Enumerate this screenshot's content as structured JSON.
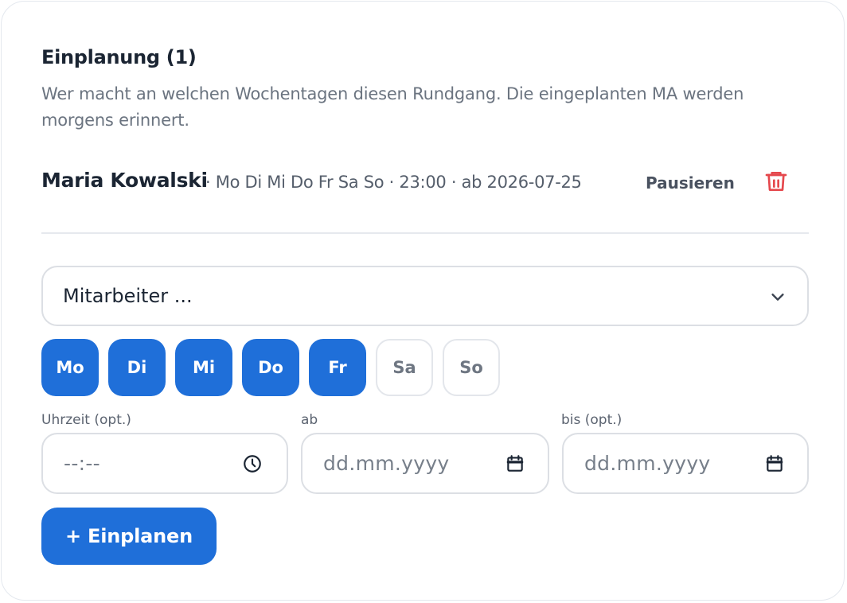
{
  "planning": {
    "title": "Einplanung (1)",
    "description": "Wer macht an welchen Wochentagen diesen Rundgang. Die eingeplanten MA werden morgens erinnert."
  },
  "assignments": [
    {
      "name": "Maria Kowalski",
      "meta": "· Mo Di Mi Do Fr Sa So · 23:00 · ab 2026-07-25",
      "pause_label": "Pausieren",
      "delete_icon": "trash-icon"
    }
  ],
  "form": {
    "employee_select": {
      "value": "Mitarbeiter ...",
      "icon": "chevron-down-icon"
    },
    "days": [
      {
        "label": "Mo",
        "selected": true
      },
      {
        "label": "Di",
        "selected": true
      },
      {
        "label": "Mi",
        "selected": true
      },
      {
        "label": "Do",
        "selected": true
      },
      {
        "label": "Fr",
        "selected": true
      },
      {
        "label": "Sa",
        "selected": false
      },
      {
        "label": "So",
        "selected": false
      }
    ],
    "time": {
      "label": "Uhrzeit (opt.)",
      "placeholder": "--:--",
      "icon": "clock-icon"
    },
    "from": {
      "label": "ab",
      "placeholder": "dd.mm.yyyy",
      "icon": "calendar-icon"
    },
    "until": {
      "label": "bis (opt.)",
      "placeholder": "dd.mm.yyyy",
      "icon": "calendar-icon"
    },
    "submit_label": "+ Einplanen"
  },
  "colors": {
    "accent": "#1f6fd9",
    "danger": "#e5484d",
    "text": "#1b2533",
    "muted": "#6b7480",
    "border": "#dcdfe4"
  }
}
